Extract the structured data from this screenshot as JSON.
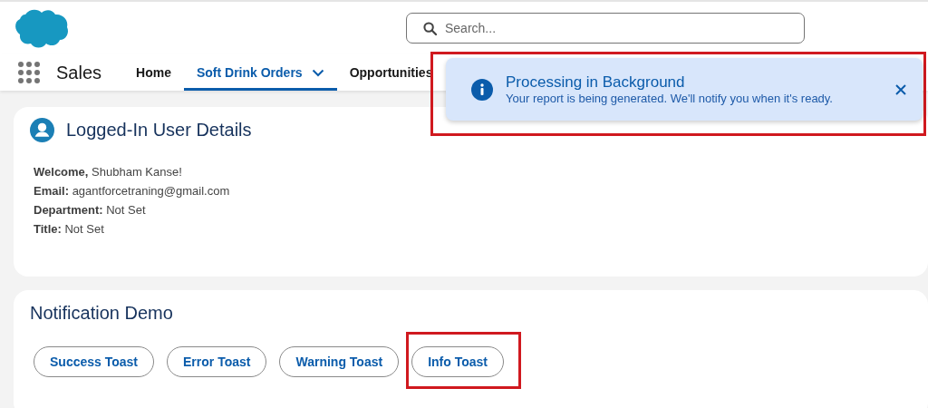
{
  "header": {
    "search": {
      "placeholder": "Search..."
    }
  },
  "nav": {
    "app_name": "Sales",
    "tabs": [
      {
        "label": "Home",
        "selected": false,
        "menu": false
      },
      {
        "label": "Soft Drink Orders",
        "selected": true,
        "menu": true
      },
      {
        "label": "Opportunities",
        "selected": false,
        "menu": false
      }
    ]
  },
  "toast": {
    "title": "Processing in Background",
    "message": "Your report is being generated. We'll notify you when it's ready.",
    "highlighted": true
  },
  "user_card": {
    "title": "Logged-In User Details",
    "lines": [
      "**Welcome,** Shubham Kanse!",
      "**Email:** agantforcetraning@gmail.com",
      "**Department:** Not Set",
      "**Title:** Not Set"
    ]
  },
  "demo_card": {
    "title": "Notification Demo",
    "buttons": [
      {
        "label": "Success Toast",
        "highlighted": false
      },
      {
        "label": "Error Toast",
        "highlighted": false
      },
      {
        "label": "Warning Toast",
        "highlighted": false
      },
      {
        "label": "Info Toast",
        "highlighted": true
      }
    ]
  }
}
